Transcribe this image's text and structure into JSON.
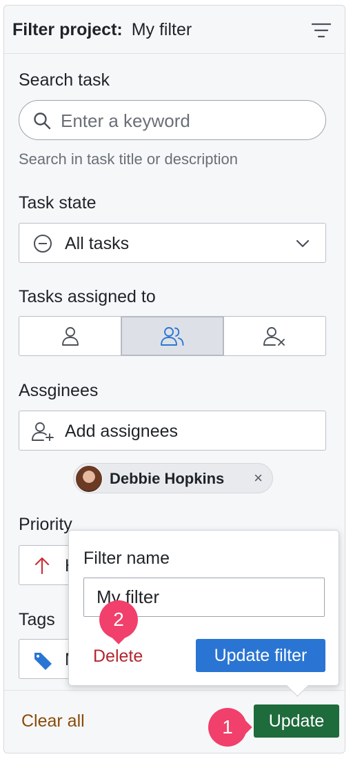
{
  "header": {
    "label": "Filter project:",
    "filter_name": "My filter",
    "icon": "filter-lines-icon"
  },
  "search": {
    "label": "Search task",
    "placeholder": "Enter a keyword",
    "value": "",
    "help": "Search in task title or description"
  },
  "task_state": {
    "label": "Task state",
    "selected": "All tasks"
  },
  "assigned_to": {
    "label": "Tasks assigned to",
    "options": [
      "me",
      "others",
      "unassigned"
    ],
    "active": "others"
  },
  "assignees": {
    "label": "Assginees",
    "add_label": "Add assignees",
    "chips": [
      {
        "name": "Debbie Hopkins",
        "remove": "×"
      }
    ]
  },
  "priority": {
    "label": "Priority",
    "partial_value": "H"
  },
  "tags": {
    "label": "Tags",
    "partial_value": "M"
  },
  "footer": {
    "clear_label": "Clear all",
    "update_label": "Update"
  },
  "popover": {
    "label": "Filter name",
    "value": "My filter",
    "delete_label": "Delete",
    "update_label": "Update filter"
  },
  "badges": {
    "one": "1",
    "two": "2"
  },
  "colors": {
    "accent": "#2a75d3",
    "update_green": "#1e6b3c",
    "badge_pink": "#f0406b",
    "delete_red": "#b3262e",
    "clear_brown": "#8a4b08"
  }
}
